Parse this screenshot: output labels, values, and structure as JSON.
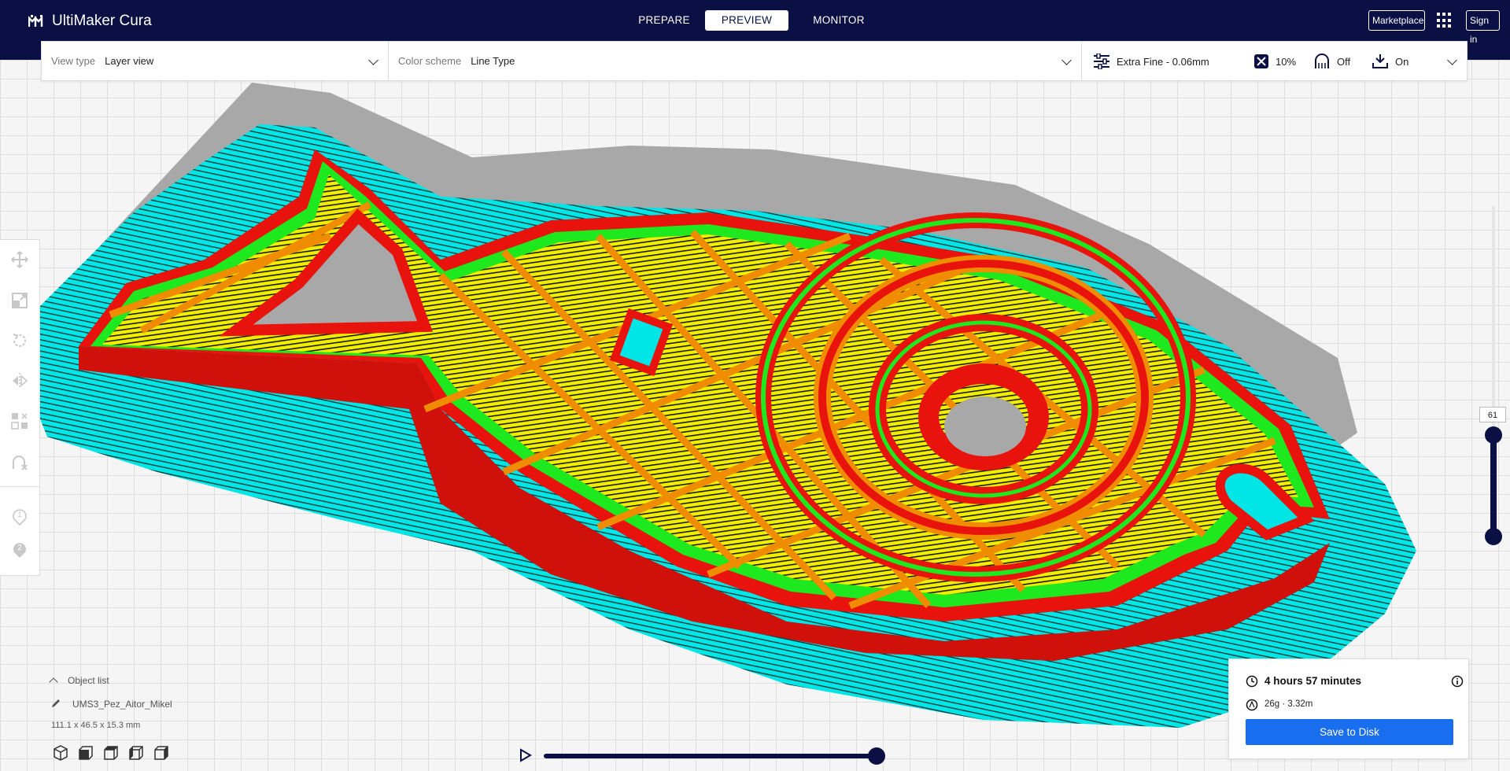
{
  "app": {
    "name": "UltiMaker Cura"
  },
  "header": {
    "stages": [
      {
        "label": "PREPARE",
        "active": false
      },
      {
        "label": "PREVIEW",
        "active": true
      },
      {
        "label": "MONITOR",
        "active": false
      }
    ],
    "marketplace_label": "Marketplace",
    "signin_label": "Sign in",
    "apps_icon": "grid-icon"
  },
  "settings_bar": {
    "view_type": {
      "label": "View type",
      "value": "Layer view"
    },
    "color_scheme": {
      "label": "Color scheme",
      "value": "Line Type"
    },
    "print_profile": {
      "profile": "Extra Fine - 0.06mm",
      "infill": "10%",
      "support": "Off",
      "adhesion": "On"
    }
  },
  "left_toolbar": {
    "tools": [
      "move-icon",
      "scale-icon",
      "rotate-icon",
      "mirror-icon",
      "per-model-settings-icon",
      "support-blocker-icon"
    ],
    "extruders": [
      "1",
      "2"
    ]
  },
  "layer_slider": {
    "current_layer": "61"
  },
  "object_list": {
    "header": "Object list",
    "object_name": "UMS3_Pez_Aitor_Mikel",
    "dimensions": "111.1 x 46.5 x 15.3 mm"
  },
  "view_buttons": [
    "3d-view-icon",
    "front-view-icon",
    "top-view-icon",
    "left-view-icon",
    "right-view-icon"
  ],
  "print_summary": {
    "time": "4 hours 57 minutes",
    "material": "26g · 3.32m",
    "save_label": "Save to Disk"
  },
  "colors": {
    "header_bg": "#0b1044",
    "accent_blue": "#196ef0",
    "skirt_cyan": "#00e5e5",
    "wall_outer_red": "#e8130d",
    "wall_inner_green": "#1ee81e",
    "infill_orange": "#f08c00",
    "skin_yellow": "#f2ee00",
    "shadow_gray": "#a8a8a8"
  }
}
